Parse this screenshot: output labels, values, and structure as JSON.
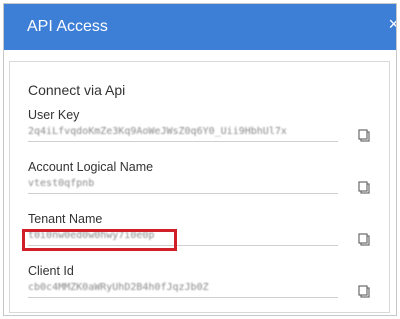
{
  "dialog": {
    "title": "API Access",
    "close_label": "×"
  },
  "section": {
    "title": "Connect via Api"
  },
  "fields": [
    {
      "label": "User Key",
      "value": "2q4iLfvqdoKmZe3Kq9AoWeJWsZ0q6Y0_Uii9HbhUl7x"
    },
    {
      "label": "Account Logical Name",
      "value": "vtest0qfpnb"
    },
    {
      "label": "Tenant Name",
      "value": "t0i0nw0ed0w0hwy7i0e0p"
    },
    {
      "label": "Client Id",
      "value": "cb0c4MMZK0aWRyUhD2B4h0fJqzJb0Z"
    }
  ],
  "highlight_color": "#d11f2a",
  "accent_color": "#3d7ed7",
  "icons": {
    "copy": "copy-icon",
    "close": "close-icon"
  }
}
